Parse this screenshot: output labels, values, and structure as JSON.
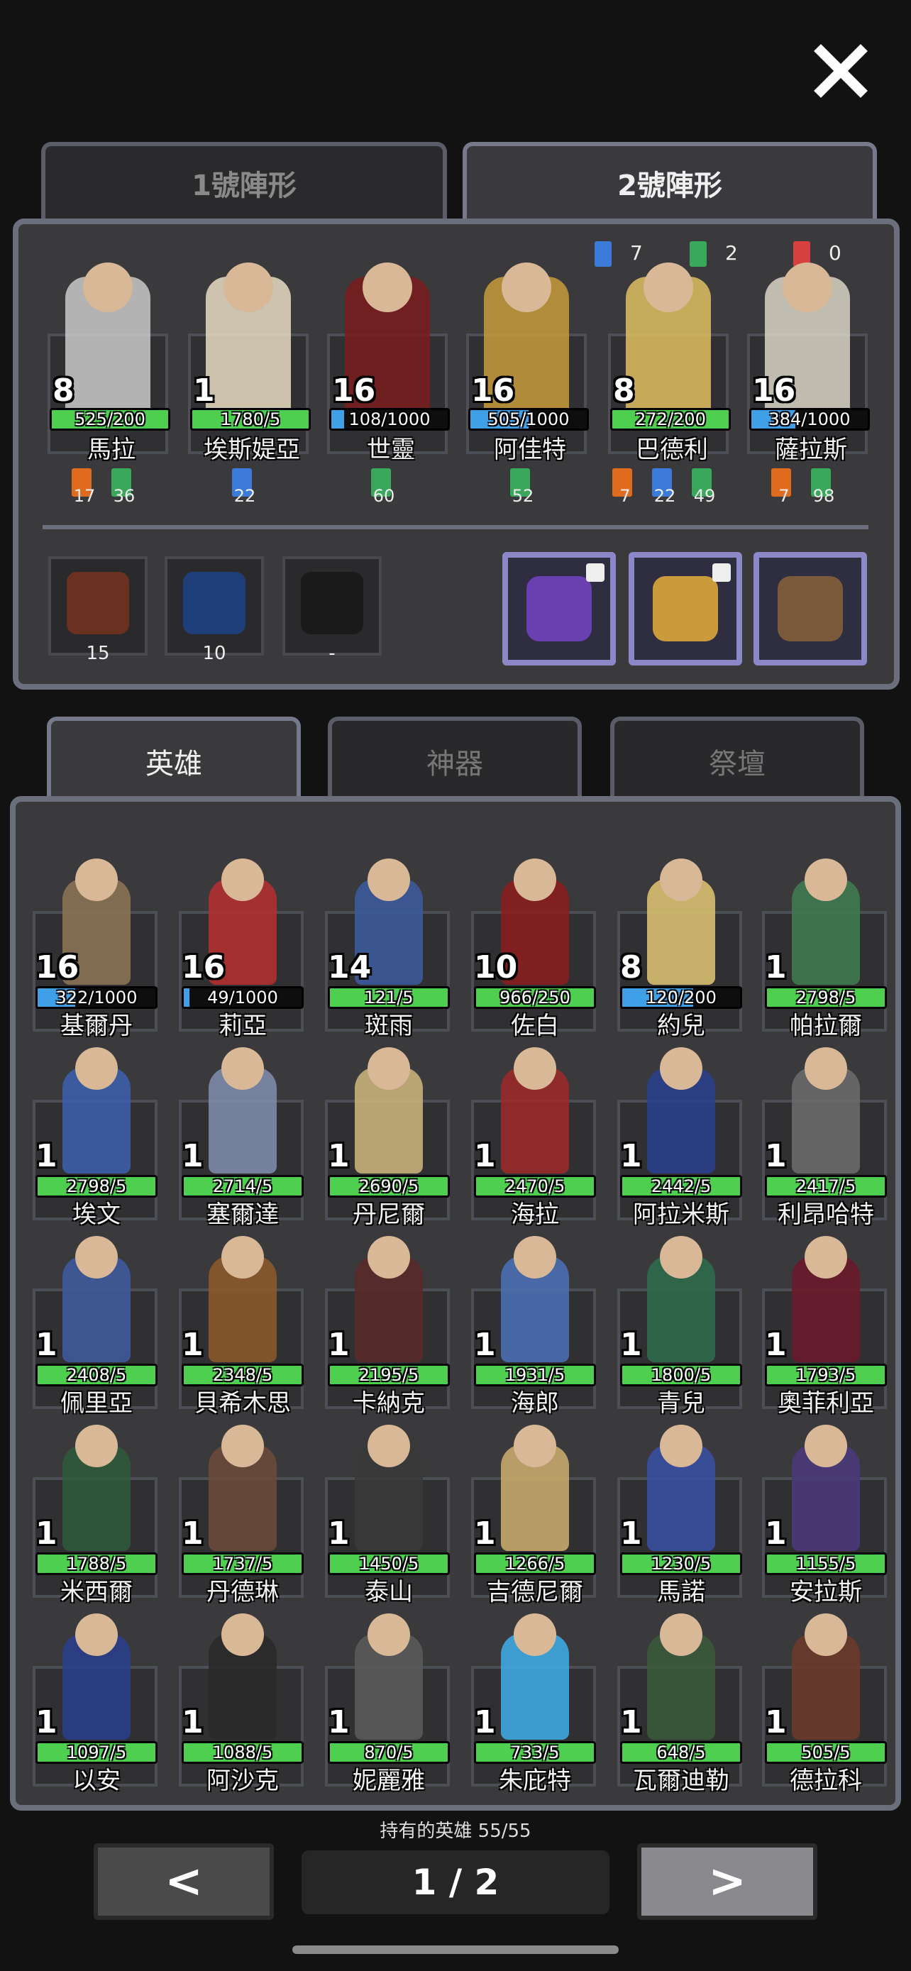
{
  "formation_tabs": [
    "1號陣形",
    "2號陣形"
  ],
  "active_formation": 1,
  "formation_stats": [
    {
      "icon": "blue-banner-icon",
      "value": "7",
      "color": "#3d7bd8"
    },
    {
      "icon": "green-banner-icon",
      "value": "2",
      "color": "#3aa85a"
    },
    {
      "icon": "red-banner-icon",
      "value": "0",
      "color": "#d84040"
    }
  ],
  "team": [
    {
      "level": "8",
      "bar": "525/200",
      "bar_color": "#4fcf4f",
      "bar_fill": 1.0,
      "name": "馬拉",
      "tint": "#c9c9c9",
      "badges": [
        {
          "color": "#e06a1e",
          "value": "17"
        },
        {
          "color": "#3aa85a",
          "value": "36"
        }
      ]
    },
    {
      "level": "1",
      "bar": "1780/5",
      "bar_color": "#4fcf4f",
      "bar_fill": 1.0,
      "name": "埃斯媞亞",
      "tint": "#e8dcc2",
      "badges": [
        {
          "color": "#3d7bd8",
          "value": "22"
        }
      ]
    },
    {
      "level": "16",
      "bar": "108/1000",
      "bar_color": "#3fa0e8",
      "bar_fill": 0.11,
      "name": "世靈",
      "tint": "#7a1c1c",
      "badges": [
        {
          "color": "#3aa85a",
          "value": "60"
        }
      ]
    },
    {
      "level": "16",
      "bar": "505/1000",
      "bar_color": "#3fa0e8",
      "bar_fill": 0.5,
      "name": "阿佳特",
      "tint": "#c79b3b",
      "badges": [
        {
          "color": "#3aa85a",
          "value": "52"
        }
      ]
    },
    {
      "level": "8",
      "bar": "272/200",
      "bar_color": "#4fcf4f",
      "bar_fill": 1.0,
      "name": "巴德利",
      "tint": "#e0c061",
      "badges": [
        {
          "color": "#e06a1e",
          "value": "7"
        },
        {
          "color": "#3d7bd8",
          "value": "22"
        },
        {
          "color": "#3aa85a",
          "value": "49"
        }
      ]
    },
    {
      "level": "16",
      "bar": "384/1000",
      "bar_color": "#3fa0e8",
      "bar_fill": 0.38,
      "name": "薩拉斯",
      "tint": "#d8d3c4",
      "badges": [
        {
          "color": "#e06a1e",
          "value": "7"
        },
        {
          "color": "#3aa85a",
          "value": "98"
        }
      ]
    }
  ],
  "equipment": [
    {
      "icon": "dark-armor-icon",
      "count": "15",
      "color": "#6a3020"
    },
    {
      "icon": "blue-armor-icon",
      "count": "10",
      "color": "#1e3f7a"
    },
    {
      "icon": "empty-slot-icon",
      "count": "-",
      "color": "#1a1a1a"
    }
  ],
  "relics": [
    {
      "icon": "purple-mask-icon",
      "color": "#6a3fb0",
      "locked": true
    },
    {
      "icon": "golden-scope-icon",
      "color": "#c99b3b",
      "locked": true
    },
    {
      "icon": "spiked-log-icon",
      "color": "#7a5a3a",
      "locked": false
    }
  ],
  "lower_tabs": [
    "英雄",
    "神器",
    "祭壇"
  ],
  "heroes": [
    {
      "level": "16",
      "bar": "322/1000",
      "bar_color": "#3fa0e8",
      "bar_fill": 0.32,
      "name": "基爾丹",
      "tint": "#8b7355"
    },
    {
      "level": "16",
      "bar": "49/1000",
      "bar_color": "#3fa0e8",
      "bar_fill": 0.05,
      "name": "莉亞",
      "tint": "#b03030"
    },
    {
      "level": "14",
      "bar": "121/5",
      "bar_color": "#4fcf4f",
      "bar_fill": 1.0,
      "name": "斑雨",
      "tint": "#3c5a9a"
    },
    {
      "level": "10",
      "bar": "966/250",
      "bar_color": "#4fcf4f",
      "bar_fill": 1.0,
      "name": "佐白",
      "tint": "#8a1e1e"
    },
    {
      "level": "8",
      "bar": "120/200",
      "bar_color": "#3fa0e8",
      "bar_fill": 0.6,
      "name": "約兒",
      "tint": "#d8c070"
    },
    {
      "level": "1",
      "bar": "2798/5",
      "bar_color": "#4fcf4f",
      "bar_fill": 1.0,
      "name": "帕拉爾",
      "tint": "#3f7a4f"
    },
    {
      "level": "1",
      "bar": "2798/5",
      "bar_color": "#4fcf4f",
      "bar_fill": 1.0,
      "name": "埃文",
      "tint": "#3d5fa8"
    },
    {
      "level": "1",
      "bar": "2714/5",
      "bar_color": "#4fcf4f",
      "bar_fill": 1.0,
      "name": "塞爾達",
      "tint": "#7d8aa8"
    },
    {
      "level": "1",
      "bar": "2690/5",
      "bar_color": "#4fcf4f",
      "bar_fill": 1.0,
      "name": "丹尼爾",
      "tint": "#c8b07a"
    },
    {
      "level": "1",
      "bar": "2470/5",
      "bar_color": "#4fcf4f",
      "bar_fill": 1.0,
      "name": "海拉",
      "tint": "#9a2a2a"
    },
    {
      "level": "1",
      "bar": "2442/5",
      "bar_color": "#4fcf4f",
      "bar_fill": 1.0,
      "name": "阿拉米斯",
      "tint": "#2a3f8a"
    },
    {
      "level": "1",
      "bar": "2417/5",
      "bar_color": "#4fcf4f",
      "bar_fill": 1.0,
      "name": "利昂哈特",
      "tint": "#6a6a6a"
    },
    {
      "level": "1",
      "bar": "2408/5",
      "bar_color": "#4fcf4f",
      "bar_fill": 1.0,
      "name": "佩里亞",
      "tint": "#3f5a9a"
    },
    {
      "level": "1",
      "bar": "2348/5",
      "bar_color": "#4fcf4f",
      "bar_fill": 1.0,
      "name": "貝希木思",
      "tint": "#8a5a2a"
    },
    {
      "level": "1",
      "bar": "2195/5",
      "bar_color": "#4fcf4f",
      "bar_fill": 1.0,
      "name": "卡納克",
      "tint": "#5a2a2a"
    },
    {
      "level": "1",
      "bar": "1931/5",
      "bar_color": "#4fcf4f",
      "bar_fill": 1.0,
      "name": "海郎",
      "tint": "#4a6fb0"
    },
    {
      "level": "1",
      "bar": "1800/5",
      "bar_color": "#4fcf4f",
      "bar_fill": 1.0,
      "name": "青兒",
      "tint": "#2f6a4a"
    },
    {
      "level": "1",
      "bar": "1793/5",
      "bar_color": "#4fcf4f",
      "bar_fill": 1.0,
      "name": "奧菲利亞",
      "tint": "#6a1a2a"
    },
    {
      "level": "1",
      "bar": "1788/5",
      "bar_color": "#4fcf4f",
      "bar_fill": 1.0,
      "name": "米西爾",
      "tint": "#2f5a3a"
    },
    {
      "level": "1",
      "bar": "1737/5",
      "bar_color": "#4fcf4f",
      "bar_fill": 1.0,
      "name": "丹德琳",
      "tint": "#6a4a3a"
    },
    {
      "level": "1",
      "bar": "1450/5",
      "bar_color": "#4fcf4f",
      "bar_fill": 1.0,
      "name": "泰山",
      "tint": "#3a3a3a"
    },
    {
      "level": "1",
      "bar": "1266/5",
      "bar_color": "#4fcf4f",
      "bar_fill": 1.0,
      "name": "吉德尼爾",
      "tint": "#c8a86a"
    },
    {
      "level": "1",
      "bar": "1230/5",
      "bar_color": "#4fcf4f",
      "bar_fill": 1.0,
      "name": "馬諾",
      "tint": "#3a4fa0"
    },
    {
      "level": "1",
      "bar": "1155/5",
      "bar_color": "#4fcf4f",
      "bar_fill": 1.0,
      "name": "安拉斯",
      "tint": "#4a3a7a"
    },
    {
      "level": "1",
      "bar": "1097/5",
      "bar_color": "#4fcf4f",
      "bar_fill": 1.0,
      "name": "以安",
      "tint": "#2a3f8a"
    },
    {
      "level": "1",
      "bar": "1088/5",
      "bar_color": "#4fcf4f",
      "bar_fill": 1.0,
      "name": "阿沙克",
      "tint": "#2a2a2a"
    },
    {
      "level": "1",
      "bar": "870/5",
      "bar_color": "#4fcf4f",
      "bar_fill": 1.0,
      "name": "妮麗雅",
      "tint": "#5a5a5a"
    },
    {
      "level": "1",
      "bar": "733/5",
      "bar_color": "#4fcf4f",
      "bar_fill": 1.0,
      "name": "朱庇特",
      "tint": "#3fa8e0"
    },
    {
      "level": "1",
      "bar": "648/5",
      "bar_color": "#4fcf4f",
      "bar_fill": 1.0,
      "name": "瓦爾迪勒",
      "tint": "#3a5a3a"
    },
    {
      "level": "1",
      "bar": "505/5",
      "bar_color": "#4fcf4f",
      "bar_fill": 1.0,
      "name": "德拉科",
      "tint": "#6a3a2a"
    }
  ],
  "owned_label": "持有的英雄 55/55",
  "pagination": {
    "prev": "<",
    "page": "1 / 2",
    "next": ">"
  }
}
